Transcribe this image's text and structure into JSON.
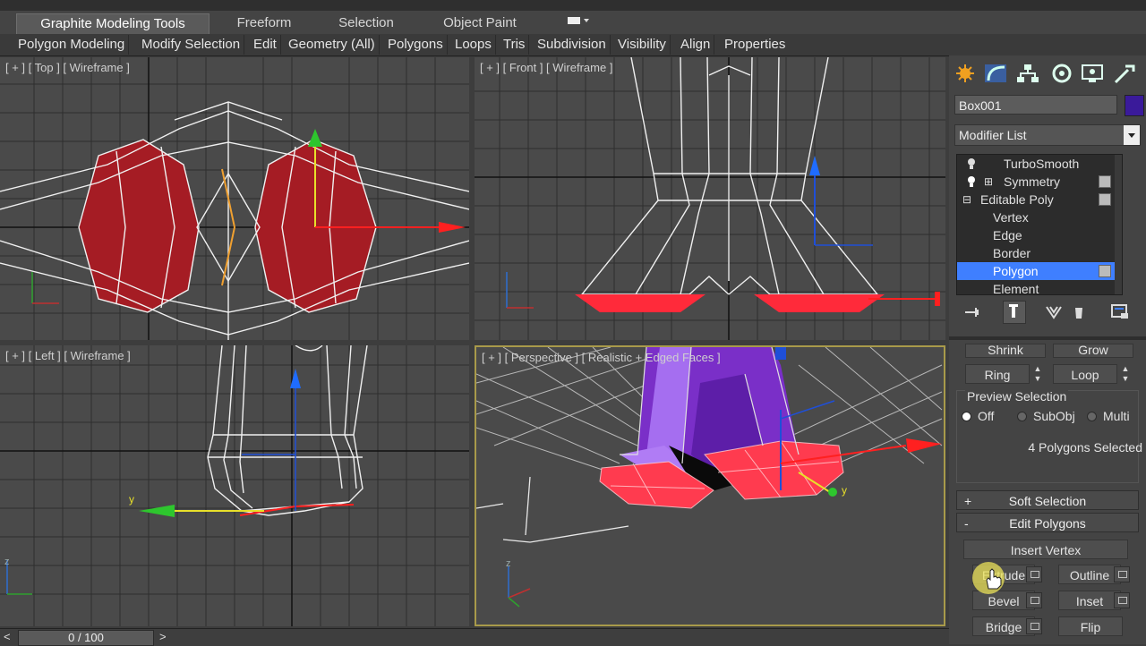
{
  "ribbon": {
    "tabs": [
      {
        "label": "Graphite Modeling Tools"
      },
      {
        "label": "Freeform"
      },
      {
        "label": "Selection"
      },
      {
        "label": "Object Paint"
      }
    ],
    "panels": [
      {
        "label": "Polygon Modeling"
      },
      {
        "label": "Modify Selection"
      },
      {
        "label": "Edit"
      },
      {
        "label": "Geometry (All)"
      },
      {
        "label": "Polygons"
      },
      {
        "label": "Loops"
      },
      {
        "label": "Tris"
      },
      {
        "label": "Subdivision"
      },
      {
        "label": "Visibility"
      },
      {
        "label": "Align"
      },
      {
        "label": "Properties"
      }
    ]
  },
  "viewports": {
    "top": {
      "label": "[ + ] [ Top ] [ Wireframe ]"
    },
    "front": {
      "label": "[ + ] [ Front ] [ Wireframe ]"
    },
    "left": {
      "label": "[ + ] [ Left ] [ Wireframe ]"
    },
    "perspective": {
      "label": "[ + ] [ Perspective ] [ Realistic + Edged Faces ]"
    }
  },
  "command_panel": {
    "object_name": "Box001",
    "object_color": "#3a1a9a",
    "modifier_list": "Modifier List",
    "stack": [
      {
        "label": "TurboSmooth"
      },
      {
        "label": "Symmetry"
      },
      {
        "label": "Editable Poly"
      },
      {
        "label": "Vertex"
      },
      {
        "label": "Edge"
      },
      {
        "label": "Border"
      },
      {
        "label": "Polygon"
      },
      {
        "label": "Element"
      }
    ],
    "selected_stack_item": "Polygon",
    "shrink_label": "Shrink",
    "grow_label": "Grow",
    "ring_label": "Ring",
    "loop_label": "Loop",
    "preview_selection": {
      "title": "Preview Selection",
      "options": [
        {
          "label": "Off"
        },
        {
          "label": "SubObj"
        },
        {
          "label": "Multi"
        }
      ],
      "selected": "Off"
    },
    "selection_status": "4 Polygons Selected",
    "soft_selection": {
      "sign": "+",
      "label": "Soft Selection"
    },
    "edit_polygons": {
      "sign": "-",
      "label": "Edit Polygons"
    },
    "buttons": {
      "insert_vertex": "Insert Vertex",
      "extrude": "Extrude",
      "outline": "Outline",
      "bevel": "Bevel",
      "inset": "Inset",
      "bridge": "Bridge",
      "flip": "Flip"
    }
  },
  "timeline": {
    "frame": "0 / 100",
    "prev": "<",
    "next": ">"
  },
  "axis_labels": {
    "y": "y",
    "z": "z"
  },
  "colors": {
    "selected_poly": "#ff3b4f",
    "selected_poly_top": "#a51c24",
    "mesh_purple": "#8a3ad8",
    "highlight_blue": "#3f7fff"
  }
}
